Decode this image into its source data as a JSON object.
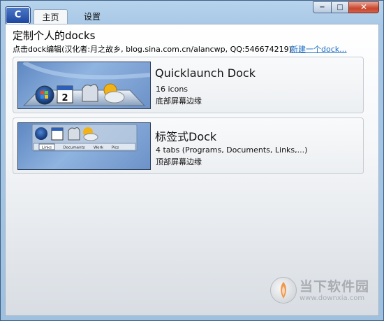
{
  "titlebar": {
    "tabs": [
      {
        "label": "主页",
        "active": true
      },
      {
        "label": "设置",
        "active": false
      }
    ],
    "buttons": {
      "minimize": "−",
      "maximize": "□",
      "close": "✕"
    }
  },
  "header": {
    "title": "定制个人的docks",
    "subtitle": "点击dock编辑(汉化者:月之故乡, blog.sina.com.cn/alancwp, QQ:546674219)",
    "new_dock_link": "新建一个dock..."
  },
  "docks": [
    {
      "title": "Quicklaunch Dock",
      "info": "16 icons",
      "position": "底部屏幕边缘"
    },
    {
      "title": "标签式Dock",
      "info": "4 tabs (Programs, Documents, Links,...)",
      "position": "顶部屏幕边缘",
      "tab_labels": [
        "Links",
        "Documents",
        "Work",
        "Pics"
      ]
    }
  ],
  "calendar_day": "2",
  "watermark": {
    "brand": "当下软件园",
    "url": "www.downxia.com"
  },
  "colors": {
    "accent": "#1f6fc4",
    "frame": "#a8c8e6",
    "close_button": "#c9452c"
  }
}
